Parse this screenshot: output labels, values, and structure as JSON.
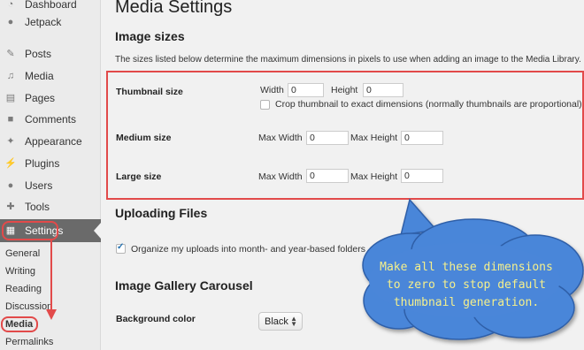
{
  "sidebar": {
    "items": [
      {
        "label": "Dashboard",
        "icon": "dashboard-icon"
      },
      {
        "label": "Jetpack",
        "icon": "jetpack-icon"
      },
      {
        "label": "Posts",
        "icon": "pin-icon"
      },
      {
        "label": "Media",
        "icon": "media-icon"
      },
      {
        "label": "Pages",
        "icon": "page-icon"
      },
      {
        "label": "Comments",
        "icon": "comment-icon"
      },
      {
        "label": "Appearance",
        "icon": "brush-icon"
      },
      {
        "label": "Plugins",
        "icon": "plug-icon"
      },
      {
        "label": "Users",
        "icon": "user-icon"
      },
      {
        "label": "Tools",
        "icon": "wrench-icon"
      },
      {
        "label": "Settings",
        "icon": "settings-icon"
      }
    ],
    "submenu": [
      "General",
      "Writing",
      "Reading",
      "Discussion",
      "Media",
      "Permalinks"
    ]
  },
  "page": {
    "title": "Media Settings",
    "image_sizes": {
      "heading": "Image sizes",
      "description": "The sizes listed below determine the maximum dimensions in pixels to use when adding an image to the Media Library.",
      "thumbnail": {
        "label": "Thumbnail size",
        "width_label": "Width",
        "width_value": "0",
        "height_label": "Height",
        "height_value": "0",
        "crop_label": "Crop thumbnail to exact dimensions (normally thumbnails are proportional)",
        "crop_checked": false
      },
      "medium": {
        "label": "Medium size",
        "max_width_label": "Max Width",
        "max_width_value": "0",
        "max_height_label": "Max Height",
        "max_height_value": "0"
      },
      "large": {
        "label": "Large size",
        "max_width_label": "Max Width",
        "max_width_value": "0",
        "max_height_label": "Max Height",
        "max_height_value": "0"
      }
    },
    "uploading": {
      "heading": "Uploading Files",
      "organize_label": "Organize my uploads into month- and year-based folders",
      "organize_checked": true
    },
    "carousel": {
      "heading": "Image Gallery Carousel",
      "bg_label": "Background color",
      "bg_value": "Black"
    }
  },
  "callout": {
    "lines": [
      "Make all these dimensions",
      "to zero to stop default",
      "thumbnail generation."
    ]
  },
  "colors": {
    "highlight": "#e24a4a",
    "bubble_fill": "#4a86d9",
    "bubble_text": "#f5f08c"
  }
}
